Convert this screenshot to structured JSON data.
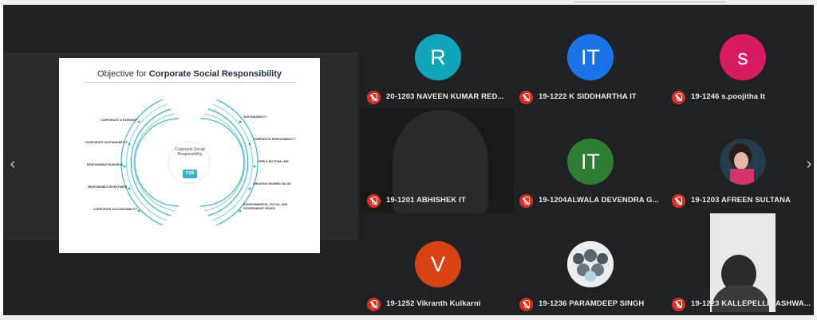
{
  "presentation": {
    "title_prefix": "Objective for",
    "title_bold": "Corporate Social Responsibility",
    "center_label": "Corporate Social Responsibility",
    "center_badge": "CSR",
    "left_items": [
      "CORPORATE CITIZENSHIP",
      "CORPORATE SUSTAINABILITY",
      "RESPONSIBLE BUSINESS",
      "RESPONSIBLE INVESTMENT",
      "CORPORATE ACCOUNTABILITY"
    ],
    "right_items": [
      "SUSTAINABILITY",
      "CORPORATE RESPONSIBILITY",
      "TRIPLE BOTTOM LINE",
      "CREATING SHARED VALUE",
      "ENVIRONMENTAL, SOCIAL AND GOVERNANCE ISSUES"
    ],
    "nav_prev": "‹",
    "nav_next": "›"
  },
  "participants": [
    {
      "initial": "R",
      "color": "#12a4b8",
      "name": "20-1203 NAVEEN KUMAR RED..."
    },
    {
      "initial": "IT",
      "color": "#1a73e8",
      "name": "19-1222 K SIDDHARTHA IT"
    },
    {
      "initial": "s",
      "color": "#d81b60",
      "name": "19-1246 s.poojitha It"
    },
    {
      "initial": "",
      "color": "",
      "name": "19-1201 ABHISHEK IT"
    },
    {
      "initial": "IT",
      "color": "#2e7d32",
      "name": "19-1204ALWALA DEVENDRA G..."
    },
    {
      "initial": "",
      "color": "",
      "name": "19-1203 AFREEN SULTANA"
    },
    {
      "initial": "V",
      "color": "#d84315",
      "name": "19-1252 Vikranth Kulkarni"
    },
    {
      "initial": "",
      "color": "",
      "name": "19-1236 PARAMDEEP SINGH"
    },
    {
      "initial": "",
      "color": "",
      "name": "19-1223 KALLEPELLI YASHWA..."
    }
  ],
  "icons": {
    "mic_off": "mic-off-icon",
    "muted_color": "#d93025"
  }
}
